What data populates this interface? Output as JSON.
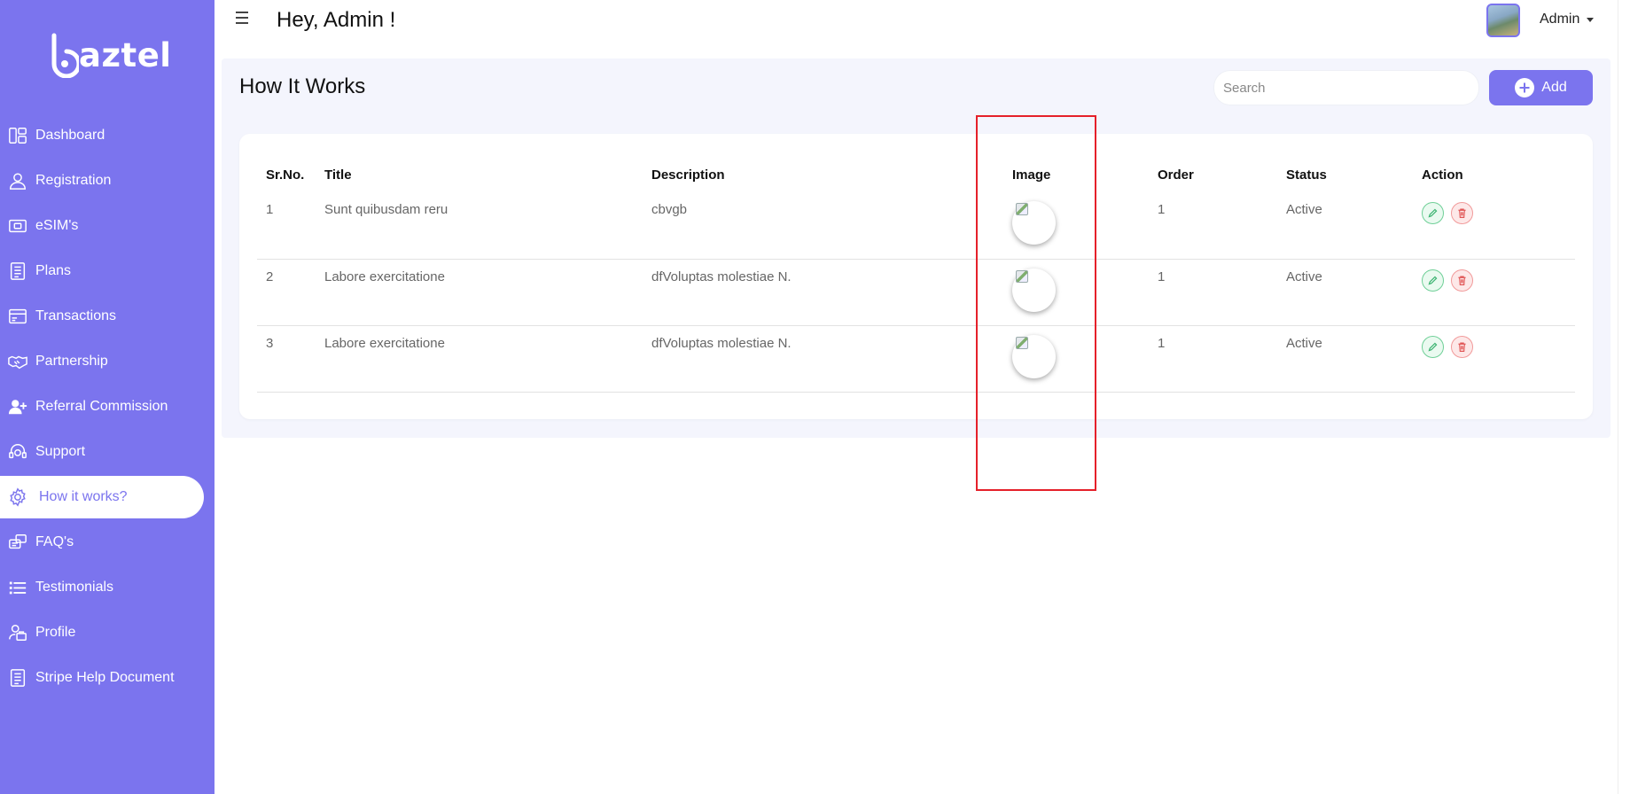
{
  "brand": {
    "logo_text": "aztel",
    "accent": "#7b74ee"
  },
  "sidebar": {
    "items": [
      {
        "label": "Dashboard",
        "icon": "dashboard-icon"
      },
      {
        "label": "Registration",
        "icon": "user-icon"
      },
      {
        "label": "eSIM's",
        "icon": "sim-icon"
      },
      {
        "label": "Plans",
        "icon": "list-icon"
      },
      {
        "label": "Transactions",
        "icon": "card-icon"
      },
      {
        "label": "Partnership",
        "icon": "handshake-icon"
      },
      {
        "label": "Referral Commission",
        "icon": "user-plus-icon"
      },
      {
        "label": "Support",
        "icon": "headset-icon"
      },
      {
        "label": "How it works?",
        "icon": "gear-icon"
      },
      {
        "label": "FAQ's",
        "icon": "chat-icon"
      },
      {
        "label": "Testimonials",
        "icon": "list-bullets-icon"
      },
      {
        "label": "Profile",
        "icon": "profile-icon"
      },
      {
        "label": "Stripe Help Document",
        "icon": "document-icon"
      }
    ],
    "active_index": 8
  },
  "header": {
    "greeting": "Hey, Admin !",
    "user_name": "Admin"
  },
  "page": {
    "title": "How It Works",
    "search_placeholder": "Search",
    "add_label": "Add"
  },
  "table": {
    "columns": [
      "Sr.No.",
      "Title",
      "Description",
      "Image",
      "Order",
      "Status",
      "Action"
    ],
    "rows": [
      {
        "sr": "1",
        "title": "Sunt quibusdam reru",
        "description": "cbvgb",
        "order": "1",
        "status": "Active"
      },
      {
        "sr": "2",
        "title": "Labore exercitatione",
        "description": "dfVoluptas molestiae N.",
        "order": "1",
        "status": "Active"
      },
      {
        "sr": "3",
        "title": "Labore exercitatione",
        "description": "dfVoluptas molestiae N.",
        "order": "1",
        "status": "Active"
      }
    ]
  },
  "colors": {
    "highlight": "#e5202a",
    "edit": "#6fcf97",
    "delete": "#f19a9a"
  }
}
